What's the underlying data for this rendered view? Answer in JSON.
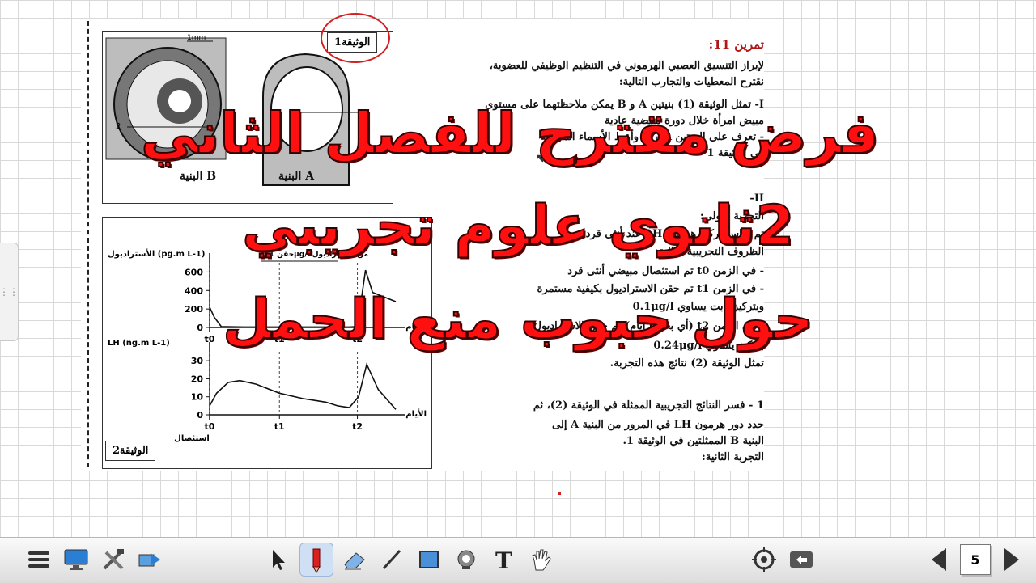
{
  "window": {
    "side_handle_icon": "grip-icon"
  },
  "document": {
    "doc1_label": "الوثيقة1",
    "doc2_label": "الوثيقة2",
    "structure_a": "البنية A",
    "structure_b": "البنية B",
    "scale_label": "1mm",
    "lines": [
      "تمرين 11:",
      "لإبراز التنسيق العصبي الهرموني في التنظيم الوظيفي للعضوية،",
      "نقترح المعطيات والتجارب التالية:",
      "I- تمثل الوثيقة (1) بنيتين A و B يمكن ملاحظتهما على مستوى",
      "مبيض امرأة خلال دورة مبيضية عادية",
      "- تعرف على البنيتين A و B وأعط الأسماء المرقمة",
      "في الوثيقة 1",
      "II-",
      "التجربة الأولى:",
      "تم قياس تركيز هرمون LH عند أنثى قرد في",
      "الظروف التجريبية التالية:",
      "- في الزمن t0 تم استئصال مبيضي أنثى قرد",
      "- في الزمن t1 تم حقن الاستراديول بكيفية مستمرة",
      "وبتركيز ثابت يساوي 0.1μg/l",
      "- في الزمن t2 (أي بعد 6 أيام) تم حقن الاستراديول",
      "بتركيز يساوي 0.24μg/l",
      "تمثل الوثيقة (2) نتائج هذه التجربة.",
      "1 - فسر النتائج التجريبية الممثلة في الوثيقة (2)، ثم",
      "حدد دور هرمون LH في المرور من البنية A إلى",
      "البنية B الممثلتين في الوثيقة 1.",
      "التجربة الثانية:"
    ]
  },
  "chart_data": [
    {
      "type": "line",
      "title": "",
      "ylabel": "الأستراديول (pg.m L-1)",
      "xlabel": "الأيام",
      "yticks": [
        "0",
        "200",
        "400",
        "600"
      ],
      "xticks": [
        "t0",
        "t1",
        "t2"
      ],
      "annotations": [
        "حقن 0.1μg/l من الأستراديول"
      ],
      "ylim": [
        0,
        700
      ],
      "series": [
        {
          "x": [
            0,
            0.4,
            1,
            3,
            6,
            9,
            11,
            12,
            12.7,
            13.4,
            14,
            16
          ],
          "values": [
            220,
            110,
            10,
            5,
            5,
            5,
            5,
            5,
            10,
            620,
            380,
            280
          ]
        }
      ]
    },
    {
      "type": "line",
      "title": "",
      "ylabel": "LH (ng.m L-1)",
      "xlabel": "الأيام",
      "yticks": [
        "0",
        "10",
        "20",
        "30"
      ],
      "xticks": [
        "t0",
        "t1",
        "t2"
      ],
      "annotation_below": "استئصال",
      "ylim": [
        0,
        35
      ],
      "series": [
        {
          "x": [
            0,
            0.6,
            1.6,
            2.6,
            4,
            6,
            8,
            10,
            11,
            12,
            12.8,
            13.5,
            14.5,
            16
          ],
          "values": [
            5,
            12,
            18,
            19,
            17,
            12,
            9,
            7,
            5,
            4,
            10,
            28,
            14,
            3
          ]
        }
      ]
    }
  ],
  "overlay": {
    "line1": "فرض مقترح للفصل الثاني",
    "line2": "2ثانوي علوم تجريبي",
    "line3": "حول حبوب منع الحمل",
    "color": "#ff1010"
  },
  "toolbar": {
    "left_icons": [
      "menu-icon",
      "monitor-icon",
      "tools-icon",
      "screen-capture-icon"
    ],
    "center_icons": [
      "pointer-icon",
      "pencil-icon",
      "eraser-icon",
      "line-icon",
      "rectangle-icon",
      "fill-icon",
      "text-icon",
      "hand-icon"
    ],
    "right_icons": [
      "target-icon",
      "undo-icon"
    ],
    "page_number": "5"
  }
}
